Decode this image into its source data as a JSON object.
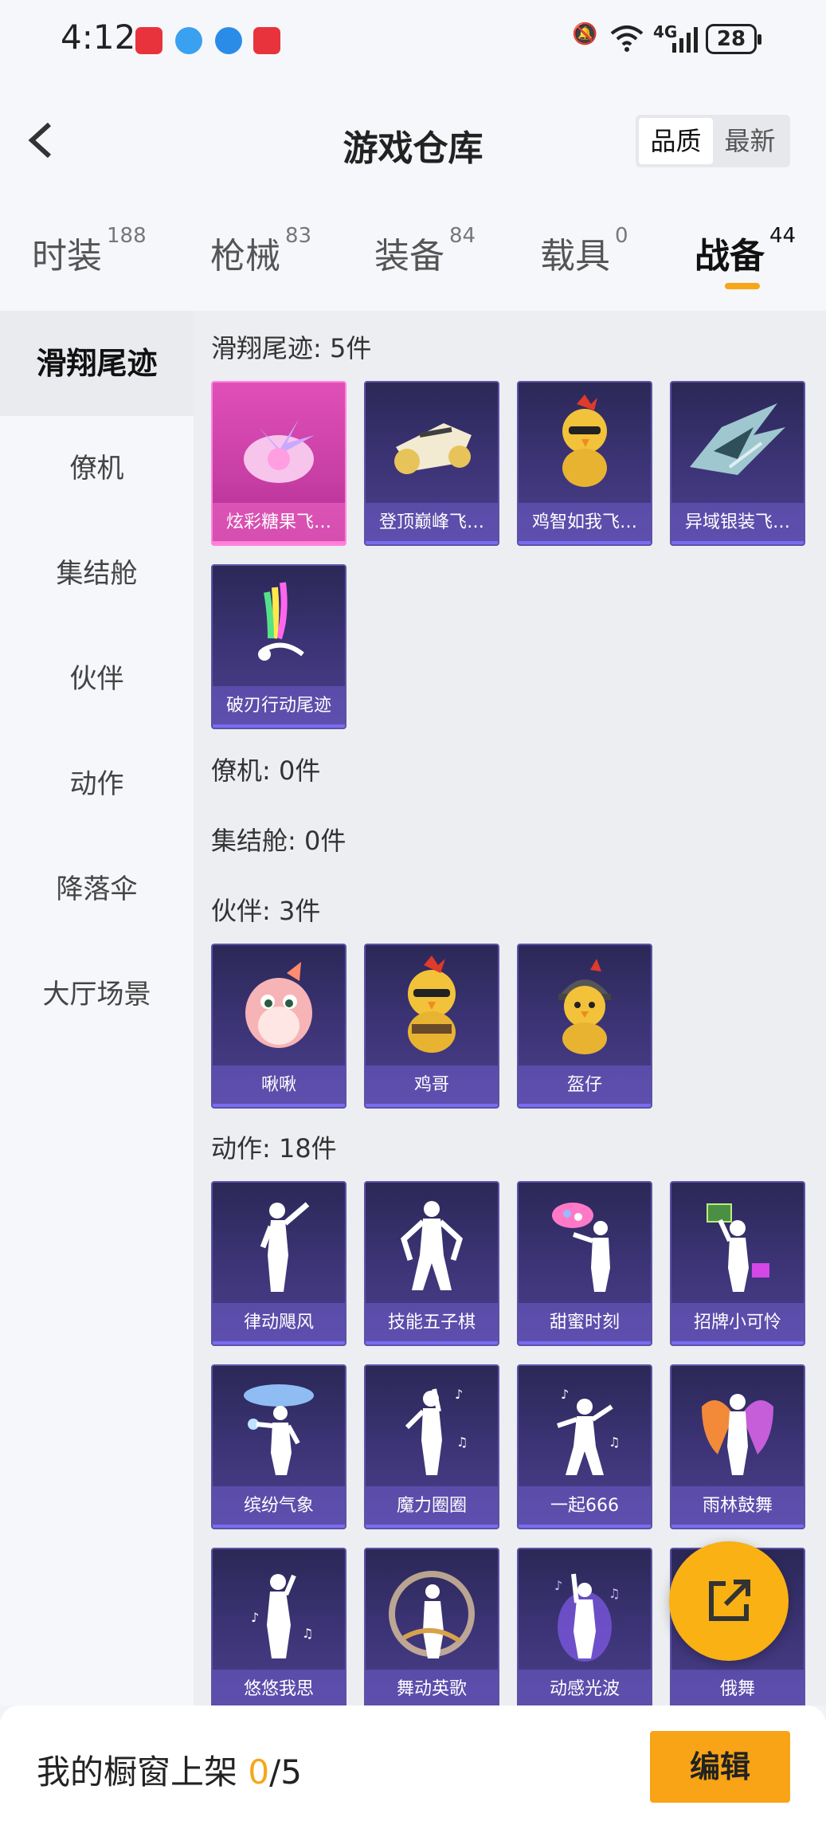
{
  "status_bar": {
    "time": "4:12",
    "battery": "28",
    "network": "4G"
  },
  "header": {
    "title": "游戏仓库",
    "sort_options": [
      "品质",
      "最新"
    ]
  },
  "tabs": [
    {
      "label": "时装",
      "count": "188"
    },
    {
      "label": "枪械",
      "count": "83"
    },
    {
      "label": "装备",
      "count": "84"
    },
    {
      "label": "载具",
      "count": "0"
    },
    {
      "label": "战备",
      "count": "44"
    }
  ],
  "sidebar": {
    "items": [
      "滑翔尾迹",
      "僚机",
      "集结舱",
      "伙伴",
      "动作",
      "降落伞",
      "大厅场景"
    ]
  },
  "sections": {
    "trails": {
      "title": "滑翔尾迹: 5件",
      "items": [
        "炫彩糖果飞…",
        "登顶巅峰飞…",
        "鸡智如我飞…",
        "异域银装飞…",
        "破刃行动尾迹"
      ]
    },
    "wingman": {
      "title": "僚机: 0件"
    },
    "pod": {
      "title": "集结舱: 0件"
    },
    "companions": {
      "title": "伙伴: 3件",
      "items": [
        "啾啾",
        "鸡哥",
        "盔仔"
      ]
    },
    "emotes": {
      "title": "动作: 18件",
      "items": [
        "律动飓风",
        "技能五子棋",
        "甜蜜时刻",
        "招牌小可怜",
        "缤纷气象",
        "魔力圈圈",
        "一起666",
        "雨林鼓舞",
        "悠悠我思",
        "舞动英歌",
        "动感光波",
        "俄舞"
      ]
    }
  },
  "bottom": {
    "prefix": "我的橱窗上架 ",
    "count": "0",
    "suffix": "/5",
    "edit_label": "编辑"
  },
  "colors": {
    "accent": "#f7a619",
    "card": "#3e3579",
    "card_highlight": "#e04fb8"
  }
}
